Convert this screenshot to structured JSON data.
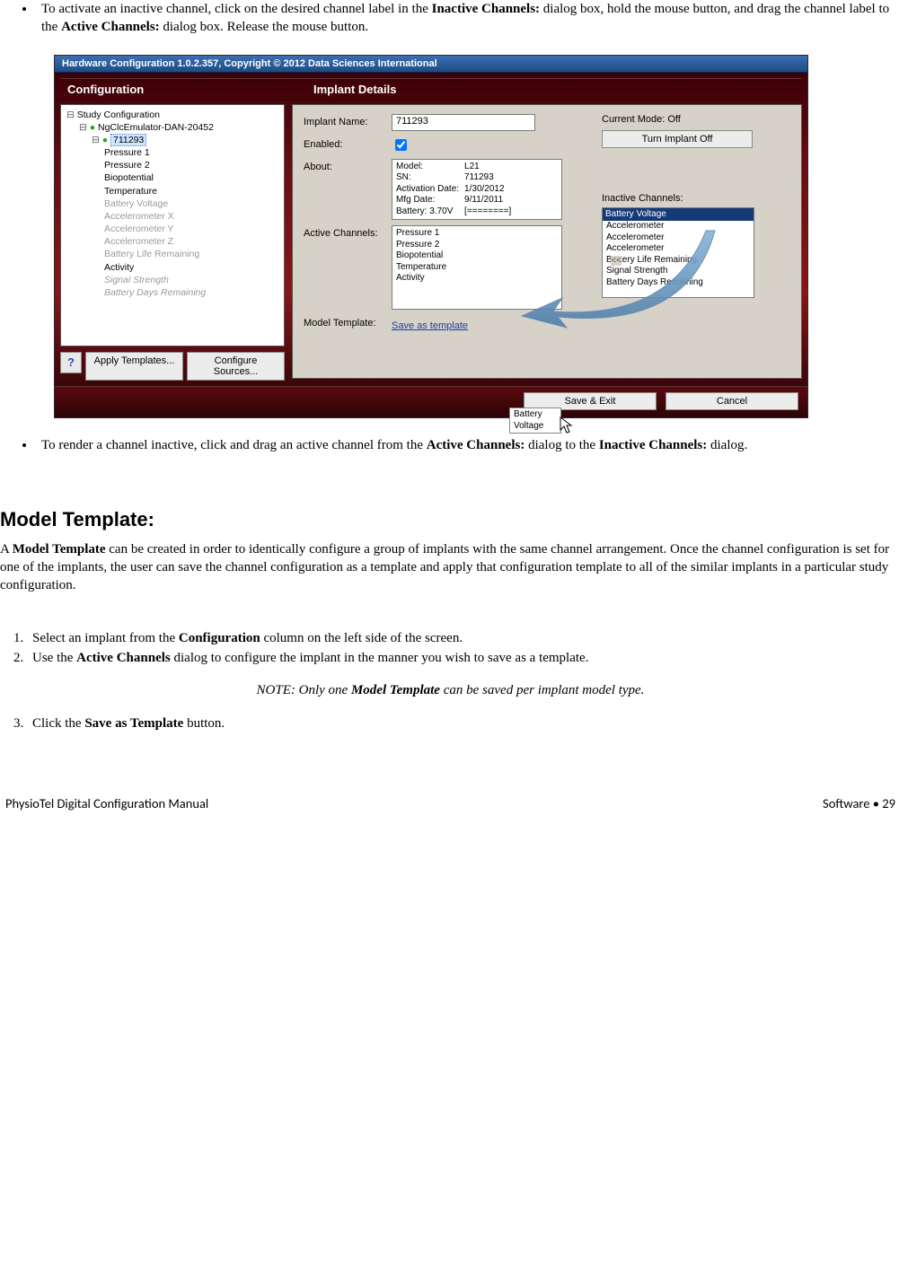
{
  "doc": {
    "bullet1_pre": "To activate an inactive channel, click on the desired channel label in the ",
    "bullet1_bold1": "Inactive Channels:",
    "bullet1_mid": " dialog box, hold the mouse button, and drag the channel label to the ",
    "bullet1_bold2": "Active Channels:",
    "bullet1_post": " dialog box. Release the mouse button.",
    "bullet2_pre": "To render a channel inactive, click and drag an active channel from the ",
    "bullet2_bold1": "Active Channels:",
    "bullet2_mid": " dialog to the ",
    "bullet2_bold2": "Inactive Channels:",
    "bullet2_post": " dialog.",
    "heading": "Model Template:",
    "para_pre": "A ",
    "para_bold": "Model Template",
    "para_post": " can be created in order to identically configure a group of implants with the same channel arrangement.  Once the channel configuration is set for one of the implants, the user can save the channel configuration as a template and apply that configuration template to all of the similar implants in a particular study configuration.",
    "step1_pre": "Select an implant from the ",
    "step1_bold": "Configuration",
    "step1_post": " column on the left side of the screen.",
    "step2_pre": "Use the ",
    "step2_bold": "Active Channels",
    "step2_post": " dialog to configure the implant in the manner you wish to save as a template.",
    "note_pre": "NOTE: Only one ",
    "note_bold": "Model Template",
    "note_post": " can be saved per implant model type.",
    "step3_pre": "Click the ",
    "step3_bold": "Save as Template",
    "step3_post": " button."
  },
  "hw": {
    "titlebar": "Hardware Configuration 1.0.2.357, Copyright © 2012 Data Sciences International",
    "col_config": "Configuration",
    "col_details": "Implant Details",
    "tree": {
      "root": "Study Configuration",
      "emulator": "NgClcEmulator-DAN-20452",
      "implant": "711293",
      "items": [
        "Pressure 1",
        "Pressure 2",
        "Biopotential",
        "Temperature"
      ],
      "grey_items": [
        "Battery Voltage",
        "Accelerometer X",
        "Accelerometer Y",
        "Accelerometer Z",
        "Battery Life Remaining"
      ],
      "items2": [
        "Activity"
      ],
      "ital_items": [
        "Signal Strength",
        "Battery Days Remaining"
      ]
    },
    "help_icon": "?",
    "btn_apply": "Apply Templates...",
    "btn_configure": "Configure Sources...",
    "labels": {
      "implant_name": "Implant Name:",
      "enabled": "Enabled:",
      "about": "About:",
      "active": "Active Channels:",
      "model_template": "Model Template:",
      "inactive": "Inactive Channels:",
      "current_mode": "Current Mode: Off"
    },
    "fields": {
      "implant_name": "711293",
      "about": {
        "model_k": "Model:",
        "model_v": "L21",
        "sn_k": "SN:",
        "sn_v": "711293",
        "act_k": "Activation Date:",
        "act_v": "1/30/2012",
        "mfg_k": "Mfg Date:",
        "mfg_v": "9/11/2011",
        "bat_k": "Battery: 3.70V",
        "bat_v": "[========]"
      },
      "active_list": [
        "Pressure 1",
        "Pressure 2",
        "Biopotential",
        "Temperature",
        "Activity"
      ],
      "drag_badge": "Battery Voltage",
      "save_template": "Save as template",
      "inactive_selected": "Battery Voltage",
      "inactive_list": [
        "Accelerometer",
        "Accelerometer",
        "Accelerometer",
        "Battery Life Remaining",
        "Signal Strength",
        "Battery Days Remaining"
      ]
    },
    "btn_turnoff": "Turn Implant Off",
    "carrier_sym": "<<",
    "btn_save": "Save & Exit",
    "btn_cancel": "Cancel"
  },
  "footer": {
    "left": "PhysioTel Digital Configuration Manual",
    "right": "Software  •  29"
  }
}
